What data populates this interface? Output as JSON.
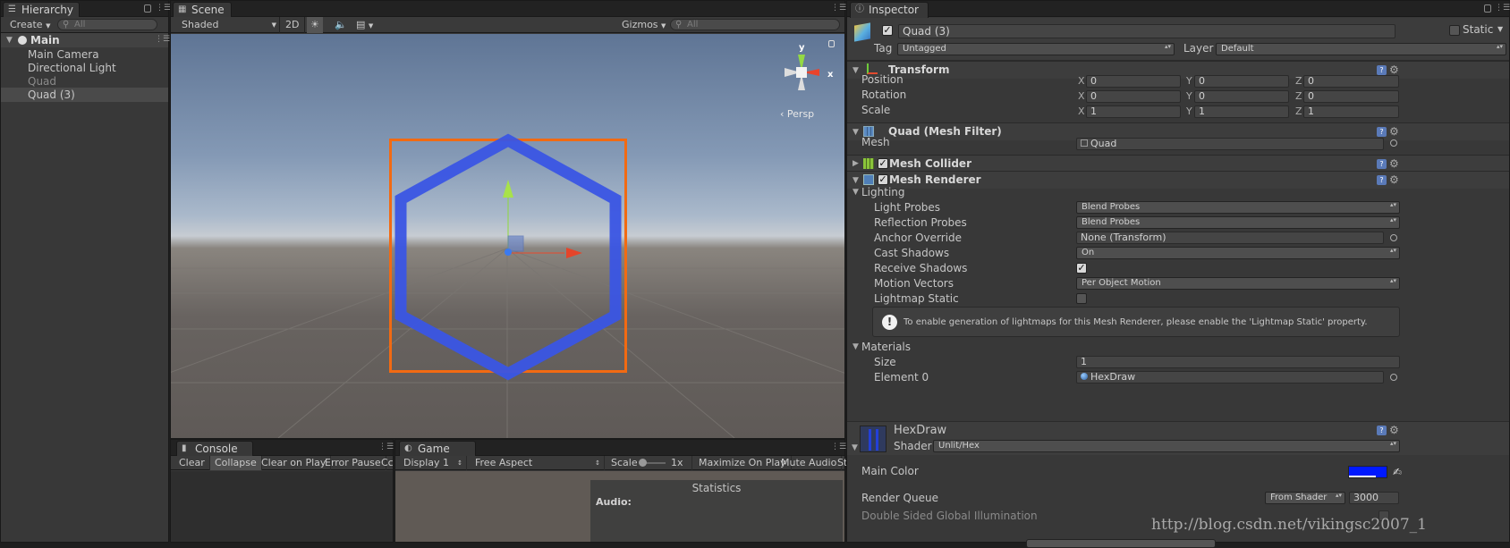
{
  "hierarchy": {
    "tab": "Hierarchy",
    "create": "Create",
    "search_placeholder": "All",
    "scene_name": "Main",
    "items": [
      "Main Camera",
      "Directional Light",
      "Quad",
      "Quad (3)"
    ]
  },
  "scene": {
    "tab": "Scene",
    "shading": "Shaded",
    "mode_2d": "2D",
    "gizmos": "Gizmos",
    "search_placeholder": "All",
    "gizmo_y": "y",
    "gizmo_x": "x",
    "persp": "Persp"
  },
  "console": {
    "tab": "Console",
    "buttons": [
      "Clear",
      "Collapse",
      "Clear on Play",
      "Error Pause",
      "Cc"
    ]
  },
  "game": {
    "tab": "Game",
    "display": "Display 1",
    "aspect": "Free Aspect",
    "scale_label": "Scale",
    "scale_value": "1x",
    "maximize": "Maximize On Play",
    "mute": "Mute Audio",
    "stats_cut": "St",
    "stats_title": "Statistics",
    "stats_audio": "Audio:"
  },
  "inspector": {
    "tab": "Inspector",
    "object_name": "Quad (3)",
    "static_label": "Static",
    "tag_label": "Tag",
    "tag_value": "Untagged",
    "layer_label": "Layer",
    "layer_value": "Default",
    "transform": {
      "title": "Transform",
      "rows": [
        {
          "label": "Position",
          "x": "0",
          "y": "0",
          "z": "0"
        },
        {
          "label": "Rotation",
          "x": "0",
          "y": "0",
          "z": "0"
        },
        {
          "label": "Scale",
          "x": "1",
          "y": "1",
          "z": "1"
        }
      ],
      "ax": "X",
      "ay": "Y",
      "az": "Z"
    },
    "mesh_filter": {
      "title": "Quad (Mesh Filter)",
      "mesh_label": "Mesh",
      "mesh_value": "Quad"
    },
    "mesh_collider": {
      "title": "Mesh Collider"
    },
    "mesh_renderer": {
      "title": "Mesh Renderer",
      "lighting": "Lighting",
      "light_probes_label": "Light Probes",
      "light_probes_value": "Blend Probes",
      "reflection_probes_label": "Reflection Probes",
      "reflection_probes_value": "Blend Probes",
      "anchor_label": "Anchor Override",
      "anchor_value": "None (Transform)",
      "cast_shadows_label": "Cast Shadows",
      "cast_shadows_value": "On",
      "receive_shadows_label": "Receive Shadows",
      "motion_vectors_label": "Motion Vectors",
      "motion_vectors_value": "Per Object Motion",
      "lightmap_static_label": "Lightmap Static",
      "info": "To enable generation of lightmaps for this Mesh Renderer, please enable the 'Lightmap Static' property.",
      "materials": "Materials",
      "size_label": "Size",
      "size_value": "1",
      "element0_label": "Element 0",
      "element0_value": "HexDraw"
    },
    "material": {
      "name": "HexDraw",
      "shader_label": "Shader",
      "shader_value": "Unlit/Hex",
      "main_color_label": "Main Color",
      "main_color": "#0019ff",
      "render_queue_label": "Render Queue",
      "render_queue_mode": "From Shader",
      "render_queue_value": "3000",
      "double_sided_label": "Double Sided Global Illumination"
    }
  },
  "watermark": "http://blog.csdn.net/vikingsc2007_1"
}
